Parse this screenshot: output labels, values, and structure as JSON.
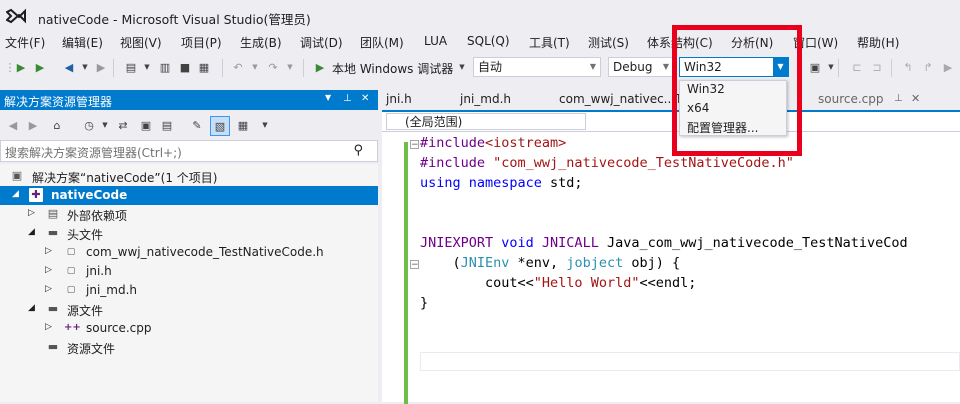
{
  "window": {
    "title": "nativeCode - Microsoft Visual Studio(管理员)"
  },
  "menu": [
    "文件(F)",
    "编辑(E)",
    "视图(V)",
    "项目(P)",
    "生成(B)",
    "调试(D)",
    "团队(M)",
    "LUA",
    "SQL(Q)",
    "工具(T)",
    "测试(S)",
    "体系结构(C)",
    "分析(N)",
    "窗口(W)",
    "帮助(H)"
  ],
  "toolbar": {
    "run_label": "本地 Windows 调试器",
    "solution_config_value": "自动",
    "config_value": "Debug",
    "platform_value": "Win32"
  },
  "platform_dropdown": {
    "options": [
      "Win32",
      "x64",
      "配置管理器..."
    ]
  },
  "solution_explorer": {
    "title": "解决方案资源管理器",
    "search_placeholder": "搜索解决方案资源管理器(Ctrl+;)",
    "tree": [
      {
        "label": "解决方案“nativeCode”(1 个项目)",
        "icon": "solution-icon"
      },
      {
        "label": "nativeCode",
        "icon": "project-icon"
      },
      {
        "label": "外部依赖项",
        "icon": "external-deps-icon"
      },
      {
        "label": "头文件",
        "icon": "folder-icon"
      },
      {
        "label": "com_wwj_nativecode_TestNativeCode.h",
        "icon": "header-file-icon"
      },
      {
        "label": "jni.h",
        "icon": "header-file-icon"
      },
      {
        "label": "jni_md.h",
        "icon": "header-file-icon"
      },
      {
        "label": "源文件",
        "icon": "folder-icon"
      },
      {
        "label": "source.cpp",
        "icon": "cpp-file-icon"
      },
      {
        "label": "资源文件",
        "icon": "folder-icon"
      }
    ]
  },
  "editor": {
    "tabs": [
      "jni.h",
      "jni_md.h",
      "com_wwj_nativec...Te",
      "source.cpp"
    ],
    "scope": "(全局范围)",
    "code": {
      "l1_kw": "#include",
      "l1_rest": "<iostream>",
      "l2_kw": "#include",
      "l2_str": " \"com_wwj_nativecode_TestNativeCode.h\"",
      "l3_kw1": "using",
      "l3_kw2": " namespace",
      "l3_rest": " std;",
      "l4_a": "JNIEXPORT",
      "l4_b": " void",
      "l4_c": " JNICALL",
      "l4_d": " Java_com_wwj_nativecode_TestNativeCod",
      "l5_open": "    (",
      "l5_t1": "JNIEnv",
      "l5_p1": " *env, ",
      "l5_t2": "jobject",
      "l5_p2": " obj) {",
      "l6_a": "        cout<<",
      "l6_str": "\"Hello World\"",
      "l6_b": "<<endl;",
      "l7": "}"
    }
  },
  "colors": {
    "accent": "#007acc",
    "highlight": "#e8001c",
    "change_bar": "#6fbe4a"
  }
}
